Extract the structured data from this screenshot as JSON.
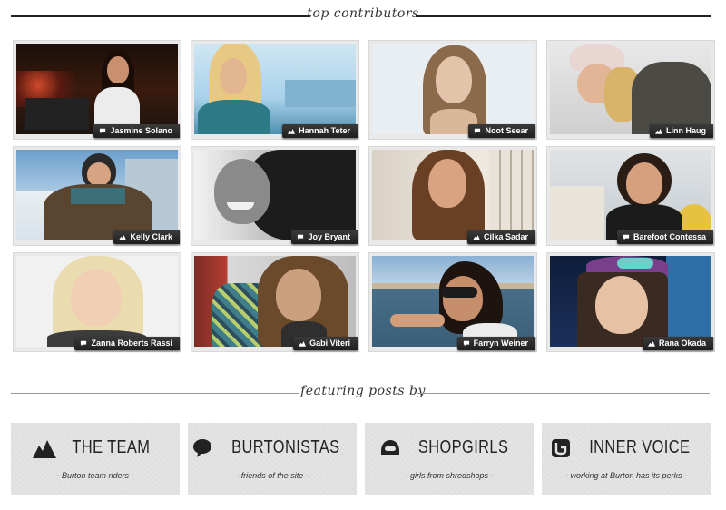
{
  "top_header": {
    "title": "top contributors"
  },
  "contributors": [
    {
      "name": "Jasmine Solano",
      "icon": "speech-bubble-icon"
    },
    {
      "name": "Hannah Teter",
      "icon": "mountain-icon"
    },
    {
      "name": "Noot Seear",
      "icon": "speech-bubble-icon"
    },
    {
      "name": "Linn Haug",
      "icon": "mountain-icon"
    },
    {
      "name": "Kelly Clark",
      "icon": "mountain-icon"
    },
    {
      "name": "Joy Bryant",
      "icon": "speech-bubble-icon"
    },
    {
      "name": "Cilka Sadar",
      "icon": "mountain-icon"
    },
    {
      "name": "Barefoot Contessa",
      "icon": "speech-bubble-icon"
    },
    {
      "name": "Zanna Roberts Rassi",
      "icon": "speech-bubble-icon"
    },
    {
      "name": "Gabi Viteri",
      "icon": "mountain-icon"
    },
    {
      "name": "Farryn Weiner",
      "icon": "speech-bubble-icon"
    },
    {
      "name": "Rana Okada",
      "icon": "mountain-icon"
    }
  ],
  "featured_header": {
    "title": "featuring posts by"
  },
  "featured": [
    {
      "title": "THE TEAM",
      "subtitle": "- Burton team riders -",
      "icon": "mountain-icon"
    },
    {
      "title": "BURTONISTAS",
      "subtitle": "- friends of the site -",
      "icon": "speech-bubble-icon"
    },
    {
      "title": "SHOPGIRLS",
      "subtitle": "- girls from shredshops -",
      "icon": "helmet-icon"
    },
    {
      "title": "INNER VOICE",
      "subtitle": "- working at Burton has its perks -",
      "icon": "burton-logo-icon"
    }
  ],
  "colors": {
    "tag_bg": "#2a2a2a",
    "card_bg": "#e9e9e9",
    "feature_bg": "#e4e4e4"
  }
}
